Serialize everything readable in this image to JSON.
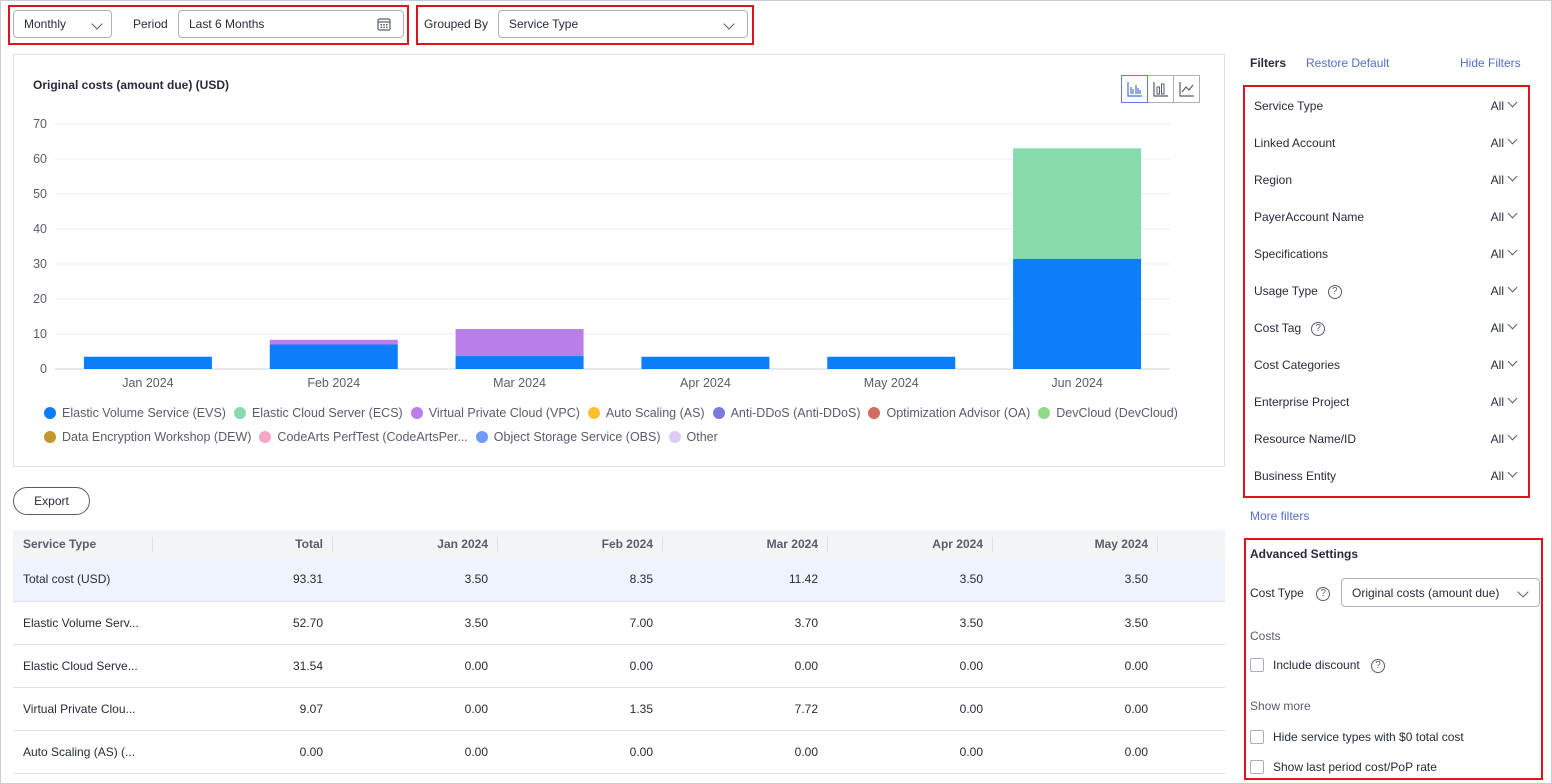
{
  "toolbar": {
    "granularity": "Monthly",
    "period_label": "Period",
    "period_value": "Last 6 Months",
    "grouped_by_label": "Grouped By",
    "grouped_by_value": "Service Type"
  },
  "chart_title": "Original costs (amount due) (USD)",
  "chart_data": {
    "type": "bar",
    "stacked": true,
    "categories": [
      "Jan 2024",
      "Feb 2024",
      "Mar 2024",
      "Apr 2024",
      "May 2024",
      "Jun 2024"
    ],
    "ylim": [
      0,
      70
    ],
    "yticks": [
      0,
      10,
      20,
      30,
      40,
      50,
      60,
      70
    ],
    "grid": true,
    "legend_position": "bottom",
    "series": [
      {
        "name": "Elastic Volume Service (EVS)",
        "color": "#0d7dfa",
        "values": [
          3.5,
          7.0,
          3.7,
          3.5,
          3.5,
          31.5
        ]
      },
      {
        "name": "Elastic Cloud Server (ECS)",
        "color": "#86dcad",
        "values": [
          0,
          0,
          0,
          0,
          0,
          31.54
        ]
      },
      {
        "name": "Virtual Private Cloud (VPC)",
        "color": "#b97ee9",
        "values": [
          0,
          1.35,
          7.72,
          0,
          0,
          0
        ]
      },
      {
        "name": "Auto Scaling (AS)",
        "color": "#fbc02d",
        "values": [
          0,
          0,
          0,
          0,
          0,
          0
        ]
      },
      {
        "name": "Anti-DDoS (Anti-DDoS)",
        "color": "#7b7bdf",
        "values": [
          0,
          0,
          0,
          0,
          0,
          0
        ]
      },
      {
        "name": "Optimization Advisor (OA)",
        "color": "#d16d5e",
        "values": [
          0,
          0,
          0,
          0,
          0,
          0
        ]
      },
      {
        "name": "DevCloud (DevCloud)",
        "color": "#8fd98a",
        "values": [
          0,
          0,
          0,
          0,
          0,
          0
        ]
      },
      {
        "name": "Data Encryption Workshop (DEW)",
        "color": "#c0972c",
        "values": [
          0,
          0,
          0,
          0,
          0,
          0
        ]
      },
      {
        "name": "CodeArts PerfTest (CodeArtsPer...",
        "color": "#f5a6c4",
        "values": [
          0,
          0,
          0,
          0,
          0,
          0
        ]
      },
      {
        "name": "Object Storage Service (OBS)",
        "color": "#6f9cf7",
        "values": [
          0,
          0,
          0,
          0,
          0,
          0
        ]
      },
      {
        "name": "Other",
        "color": "#dccbf5",
        "values": [
          0,
          0,
          0,
          0,
          0,
          0
        ]
      }
    ]
  },
  "export_label": "Export",
  "table": {
    "headers": [
      "Service Type",
      "Total",
      "Jan 2024",
      "Feb 2024",
      "Mar 2024",
      "Apr 2024",
      "May 2024"
    ],
    "rows": [
      [
        "Total cost (USD)",
        "93.31",
        "3.50",
        "8.35",
        "11.42",
        "3.50",
        "3.50"
      ],
      [
        "Elastic Volume Serv...",
        "52.70",
        "3.50",
        "7.00",
        "3.70",
        "3.50",
        "3.50"
      ],
      [
        "Elastic Cloud Serve...",
        "31.54",
        "0.00",
        "0.00",
        "0.00",
        "0.00",
        "0.00"
      ],
      [
        "Virtual Private Clou...",
        "9.07",
        "0.00",
        "1.35",
        "7.72",
        "0.00",
        "0.00"
      ],
      [
        "Auto Scaling (AS) (...",
        "0.00",
        "0.00",
        "0.00",
        "0.00",
        "0.00",
        "0.00"
      ]
    ]
  },
  "filters": {
    "title": "Filters",
    "restore_default": "Restore Default",
    "hide_filters": "Hide Filters",
    "items": [
      {
        "label": "Service Type",
        "value": "All",
        "help": false
      },
      {
        "label": "Linked Account",
        "value": "All",
        "help": false
      },
      {
        "label": "Region",
        "value": "All",
        "help": false
      },
      {
        "label": "PayerAccount Name",
        "value": "All",
        "help": false
      },
      {
        "label": "Specifications",
        "value": "All",
        "help": false
      },
      {
        "label": "Usage Type",
        "value": "All",
        "help": true
      },
      {
        "label": "Cost Tag",
        "value": "All",
        "help": true
      },
      {
        "label": "Cost Categories",
        "value": "All",
        "help": false
      },
      {
        "label": "Enterprise Project",
        "value": "All",
        "help": false
      },
      {
        "label": "Resource Name/ID",
        "value": "All",
        "help": false
      },
      {
        "label": "Business Entity",
        "value": "All",
        "help": false
      }
    ],
    "more_filters": "More filters"
  },
  "advanced": {
    "title": "Advanced Settings",
    "cost_type_label": "Cost Type",
    "cost_type_value": "Original costs (amount due)",
    "costs_label": "Costs",
    "include_discount": "Include discount",
    "show_more": "Show more",
    "hide_zero": "Hide service types with $0 total cost",
    "show_last_period": "Show last period cost/PoP rate"
  },
  "colors": {
    "accent": "#526ecc",
    "highlight": "#e0121b"
  }
}
